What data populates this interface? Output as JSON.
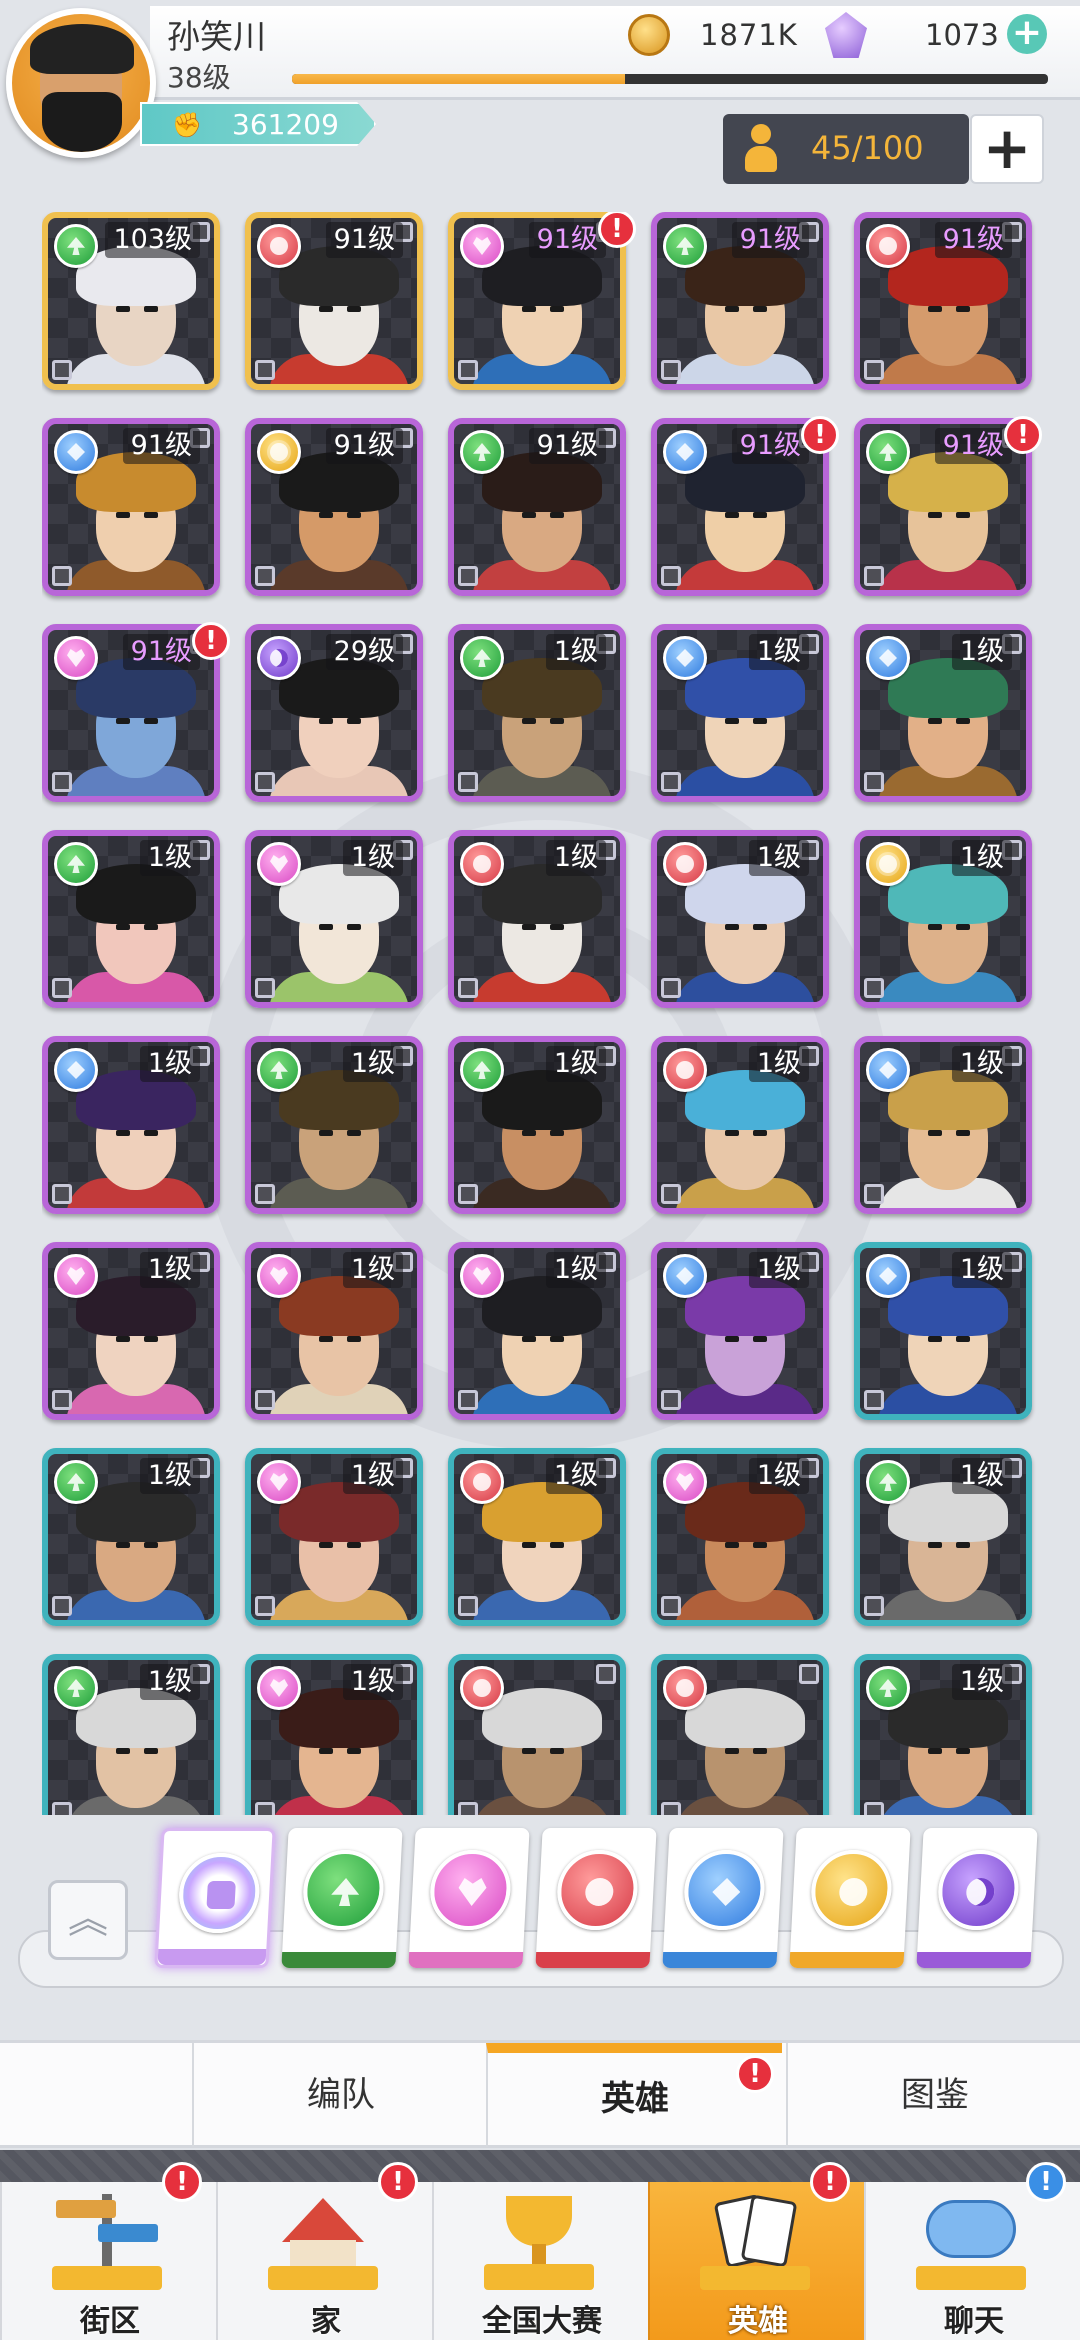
{
  "player": {
    "name": "孙笑川",
    "level": "38级",
    "xp_progress": 0.44,
    "power": "361209",
    "coins": "1871K",
    "gems": "1073"
  },
  "roster": {
    "capacity": "45/100"
  },
  "heroes": [
    {
      "level": "103级",
      "suit": "spade",
      "frame": "gold",
      "level_color": "white",
      "alert": false,
      "hair": "#e9e9ee",
      "skin": "#e8d5c4",
      "body": "#dfe2ea"
    },
    {
      "level": "91级",
      "suit": "club",
      "frame": "gold",
      "level_color": "white",
      "alert": false,
      "hair": "#2a2a2a",
      "skin": "#ece8e3",
      "body": "#c73b2f"
    },
    {
      "level": "91级",
      "suit": "heart",
      "frame": "gold",
      "level_color": "pink",
      "alert": true,
      "hair": "#1e1e22",
      "skin": "#efd2b3",
      "body": "#2e6fb8"
    },
    {
      "level": "91级",
      "suit": "spade",
      "frame": "purple",
      "level_color": "pink",
      "alert": false,
      "hair": "#3a2418",
      "skin": "#e9c8a6",
      "body": "#ccd6e8"
    },
    {
      "level": "91级",
      "suit": "club",
      "frame": "purple",
      "level_color": "pink",
      "alert": false,
      "hair": "#b3261e",
      "skin": "#d59b6c",
      "body": "#c07a4a"
    },
    {
      "level": "91级",
      "suit": "diamond",
      "frame": "purple",
      "level_color": "white",
      "alert": false,
      "hair": "#c88b2e",
      "skin": "#efcfae",
      "body": "#8f5a2b"
    },
    {
      "level": "91级",
      "suit": "sun",
      "frame": "purple",
      "level_color": "white",
      "alert": false,
      "hair": "#1a1a1a",
      "skin": "#d59a68",
      "body": "#5a3a2a"
    },
    {
      "level": "91级",
      "suit": "spade",
      "frame": "purple",
      "level_color": "white",
      "alert": false,
      "hair": "#2a1c18",
      "skin": "#d9a982",
      "body": "#c24040"
    },
    {
      "level": "91级",
      "suit": "diamond",
      "frame": "purple",
      "level_color": "pink",
      "alert": true,
      "hair": "#1f2330",
      "skin": "#efcfa7",
      "body": "#c43a3a"
    },
    {
      "level": "91级",
      "suit": "spade",
      "frame": "purple",
      "level_color": "pink",
      "alert": true,
      "hair": "#d6b14a",
      "skin": "#e7c39a",
      "body": "#b8324a"
    },
    {
      "level": "91级",
      "suit": "heart",
      "frame": "purple",
      "level_color": "pink",
      "alert": true,
      "hair": "#2a3a66",
      "skin": "#7fa7d9",
      "body": "#5f7fc0"
    },
    {
      "level": "29级",
      "suit": "moon",
      "frame": "purple",
      "level_color": "white",
      "alert": false,
      "hair": "#1a1a1a",
      "skin": "#f0d0bd",
      "body": "#e8c7b6"
    },
    {
      "level": "1级",
      "suit": "spade",
      "frame": "purple",
      "level_color": "white",
      "alert": false,
      "hair": "#4a3a20",
      "skin": "#c9a27a",
      "body": "#5c5c52"
    },
    {
      "level": "1级",
      "suit": "diamond",
      "frame": "purple",
      "level_color": "white",
      "alert": false,
      "hair": "#3050a8",
      "skin": "#efd4b8",
      "body": "#2b4fa3"
    },
    {
      "level": "1级",
      "suit": "diamond",
      "frame": "purple",
      "level_color": "white",
      "alert": false,
      "hair": "#2f7a55",
      "skin": "#e2b088",
      "body": "#9a6a30"
    },
    {
      "level": "1级",
      "suit": "spade",
      "frame": "purple",
      "level_color": "white",
      "alert": false,
      "hair": "#1a1a1a",
      "skin": "#f1c7bc",
      "body": "#d858a8"
    },
    {
      "level": "1级",
      "suit": "heart",
      "frame": "purple",
      "level_color": "white",
      "alert": false,
      "hair": "#e8e8e8",
      "skin": "#f2e6d8",
      "body": "#9bc46a"
    },
    {
      "level": "1级",
      "suit": "club",
      "frame": "purple",
      "level_color": "white",
      "alert": false,
      "hair": "#2a2a2a",
      "skin": "#ece8e3",
      "body": "#c73b2f"
    },
    {
      "level": "1级",
      "suit": "club",
      "frame": "purple",
      "level_color": "white",
      "alert": false,
      "hair": "#cfd6ec",
      "skin": "#ebcdb4",
      "body": "#2d4f9e"
    },
    {
      "level": "1级",
      "suit": "sun",
      "frame": "purple",
      "level_color": "white",
      "alert": false,
      "hair": "#4fb8b8",
      "skin": "#ddb18a",
      "body": "#3a8ac0"
    },
    {
      "level": "1级",
      "suit": "diamond",
      "frame": "purple",
      "level_color": "white",
      "alert": false,
      "hair": "#3a2560",
      "skin": "#efd0bb",
      "body": "#c23a3a"
    },
    {
      "level": "1级",
      "suit": "spade",
      "frame": "purple",
      "level_color": "white",
      "alert": false,
      "hair": "#4a3a20",
      "skin": "#c9a27a",
      "body": "#5c5c52"
    },
    {
      "level": "1级",
      "suit": "spade",
      "frame": "purple",
      "level_color": "white",
      "alert": false,
      "hair": "#1a1a1a",
      "skin": "#c88f63",
      "body": "#3a2a22"
    },
    {
      "level": "1级",
      "suit": "club",
      "frame": "purple",
      "level_color": "white",
      "alert": false,
      "hair": "#4ab0d8",
      "skin": "#e8c7a8",
      "body": "#c9a04a"
    },
    {
      "level": "1级",
      "suit": "diamond",
      "frame": "purple",
      "level_color": "white",
      "alert": false,
      "hair": "#c9a04a",
      "skin": "#e5bc93",
      "body": "#e6e6e6"
    },
    {
      "level": "1级",
      "suit": "heart",
      "frame": "purple",
      "level_color": "white",
      "alert": false,
      "hair": "#2a1c2a",
      "skin": "#efd3c0",
      "body": "#d868b0"
    },
    {
      "level": "1级",
      "suit": "heart",
      "frame": "purple",
      "level_color": "white",
      "alert": false,
      "hair": "#8a3a22",
      "skin": "#e8c4a6",
      "body": "#e0d2b8"
    },
    {
      "level": "1级",
      "suit": "heart",
      "frame": "purple",
      "level_color": "white",
      "alert": false,
      "hair": "#1e1e22",
      "skin": "#efd2b3",
      "body": "#2e6fb8"
    },
    {
      "level": "1级",
      "suit": "diamond",
      "frame": "purple",
      "level_color": "white",
      "alert": false,
      "hair": "#7a3aa8",
      "skin": "#c9a2d8",
      "body": "#5a2a88"
    },
    {
      "level": "1级",
      "suit": "diamond",
      "frame": "teal",
      "level_color": "white",
      "alert": false,
      "hair": "#3050a8",
      "skin": "#efd4b8",
      "body": "#2b4fa3"
    },
    {
      "level": "1级",
      "suit": "spade",
      "frame": "teal",
      "level_color": "white",
      "alert": false,
      "hair": "#2a2a2a",
      "skin": "#d9a982",
      "body": "#3a68b0"
    },
    {
      "level": "1级",
      "suit": "heart",
      "frame": "teal",
      "level_color": "white",
      "alert": false,
      "hair": "#7a2a2a",
      "skin": "#e9c0a8",
      "body": "#d8a85a"
    },
    {
      "level": "1级",
      "suit": "club",
      "frame": "teal",
      "level_color": "white",
      "alert": false,
      "hair": "#d9a030",
      "skin": "#f0d4bd",
      "body": "#3a68b0"
    },
    {
      "level": "1级",
      "suit": "heart",
      "frame": "teal",
      "level_color": "white",
      "alert": false,
      "hair": "#6a2a1a",
      "skin": "#c98a5c",
      "body": "#b0603a"
    },
    {
      "level": "1级",
      "suit": "spade",
      "frame": "teal",
      "level_color": "white",
      "alert": false,
      "hair": "#d8d8d8",
      "skin": "#d9b596",
      "body": "#6a6a6a"
    },
    {
      "level": "1级",
      "suit": "spade",
      "frame": "teal",
      "level_color": "white",
      "alert": false,
      "hair": "#d8d8d8",
      "skin": "#e2c2a4",
      "body": "#6a6a6a"
    },
    {
      "level": "1级",
      "suit": "heart",
      "frame": "teal",
      "level_color": "white",
      "alert": false,
      "hair": "#3a1c18",
      "skin": "#e4b590",
      "body": "#c0304a"
    },
    {
      "level": "",
      "suit": "club",
      "frame": "teal",
      "level_color": "white",
      "alert": false,
      "hair": "#d8d8d8",
      "skin": "#b8936e",
      "body": "#6a5040"
    },
    {
      "level": "",
      "suit": "club",
      "frame": "teal",
      "level_color": "white",
      "alert": false,
      "hair": "#d8d8d8",
      "skin": "#b8936e",
      "body": "#6a5040"
    },
    {
      "level": "1级",
      "suit": "spade",
      "frame": "teal",
      "level_color": "white",
      "alert": false,
      "hair": "#2a2a2a",
      "skin": "#d9a982",
      "body": "#3a68b0"
    }
  ],
  "filters": [
    {
      "id": "all",
      "icon": "all-filter-icon",
      "strip_color": "#c89af0",
      "selected": true
    },
    {
      "id": "spade",
      "icon": "spade-filter-icon",
      "strip_color": "#3a8a3a",
      "selected": false
    },
    {
      "id": "heart",
      "icon": "heart-filter-icon",
      "strip_color": "#e070c0",
      "selected": false
    },
    {
      "id": "club",
      "icon": "club-filter-icon",
      "strip_color": "#d9404a",
      "selected": false
    },
    {
      "id": "diamond",
      "icon": "diamond-filter-icon",
      "strip_color": "#3a86d9",
      "selected": false
    },
    {
      "id": "sun",
      "icon": "sun-filter-icon",
      "strip_color": "#f0a82a",
      "selected": false
    },
    {
      "id": "moon",
      "icon": "moon-filter-icon",
      "strip_color": "#9a5ad8",
      "selected": false
    }
  ],
  "tabs": [
    {
      "label": "编队",
      "active": false,
      "alert": false
    },
    {
      "label": "英雄",
      "active": true,
      "alert": true
    },
    {
      "label": "图鉴",
      "active": false,
      "alert": false
    }
  ],
  "nav": [
    {
      "label": "街区",
      "icon": "signpost-icon",
      "active": false,
      "alert": "red"
    },
    {
      "label": "家",
      "icon": "house-icon",
      "active": false,
      "alert": "red"
    },
    {
      "label": "全国大赛",
      "icon": "trophy-icon",
      "active": false,
      "alert": ""
    },
    {
      "label": "英雄",
      "icon": "hero-cards-icon",
      "active": true,
      "alert": "red"
    },
    {
      "label": "聊天",
      "icon": "chat-bubble-icon",
      "active": false,
      "alert": "blue"
    }
  ],
  "alert_mark": "!",
  "colors": {
    "accent_orange": "#f5a623",
    "frame_gold": "#f0c04e",
    "frame_purple": "#b866d8",
    "frame_teal": "#3fb3bd",
    "alert_red": "#e6303d"
  }
}
